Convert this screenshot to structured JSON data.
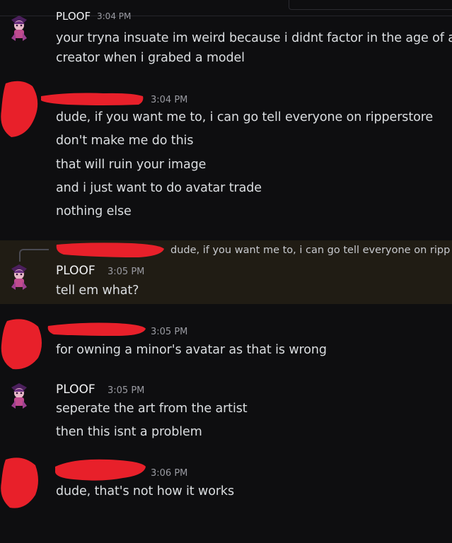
{
  "colors": {
    "background": "#0e0e10",
    "highlight": "#201c14",
    "redaction": "#e8202a",
    "name": "#f2f3f5",
    "text": "#dbdee1",
    "time": "#9a9ba2"
  },
  "messages": [
    {
      "author": "PLOOF",
      "time": "3:04 PM",
      "lines": [
        "your tryna insuate im weird because i didnt factor in the age of a",
        "creator when i grabed a model"
      ]
    },
    {
      "author": "",
      "time": "3:04 PM",
      "lines": [
        "dude, if you want me to, i can go tell everyone on ripperstore",
        "don't make me do this",
        "that will ruin your image",
        "and i just want to do avatar trade",
        "nothing else"
      ]
    },
    {
      "author": "PLOOF",
      "time": "3:05 PM",
      "reply_preview": "dude, if you want me to, i can go tell everyone on ripp",
      "lines": [
        "tell em what?"
      ]
    },
    {
      "author": "",
      "time": "3:05 PM",
      "lines": [
        "for owning a minor's avatar as that is wrong"
      ]
    },
    {
      "author": "PLOOF",
      "time": "3:05 PM",
      "lines": [
        "seperate the art from the artist",
        "then this isnt a problem"
      ]
    },
    {
      "author": "",
      "time": "3:06 PM",
      "lines": [
        "dude, that's not how it works"
      ]
    }
  ]
}
